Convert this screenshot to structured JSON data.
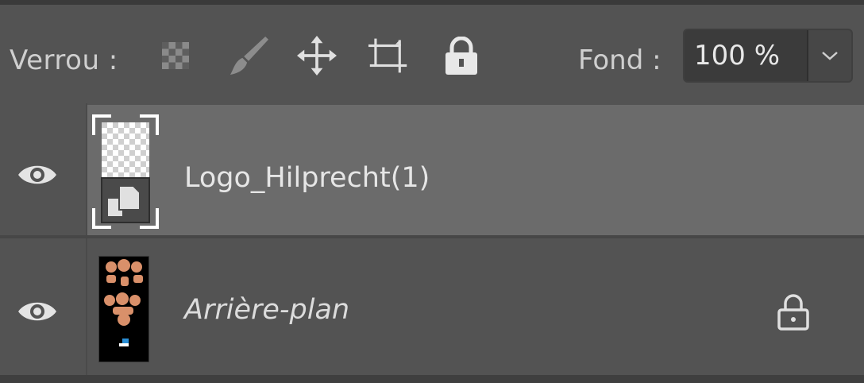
{
  "lock": {
    "label": "Verrou :",
    "icons": [
      "lock-transparent-pixels-icon",
      "lock-image-pixels-icon",
      "lock-position-icon",
      "lock-artboard-icon",
      "lock-all-icon"
    ]
  },
  "fill": {
    "label": "Fond :",
    "value": "100 %"
  },
  "layers": [
    {
      "name": "Logo_Hilprecht(1)",
      "visible": true,
      "selected": true,
      "type": "smart-object"
    },
    {
      "name": "Arrière-plan",
      "visible": true,
      "selected": false,
      "locked": true
    }
  ],
  "colors": {
    "panel": "#535353",
    "selected_row": "#6b6b6b",
    "thumbnail_accent": "#d9906a"
  }
}
